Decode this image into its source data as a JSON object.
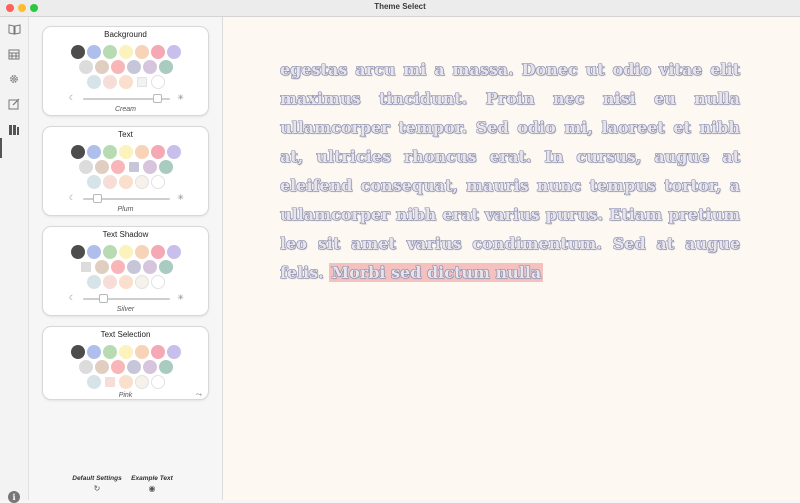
{
  "window": {
    "title": "Theme Select"
  },
  "sidebar": {
    "items": [
      {
        "name": "book-open-icon",
        "glyph": "📖"
      },
      {
        "name": "calendar-icon",
        "glyph": "▦"
      },
      {
        "name": "gear-icon",
        "glyph": "⚙"
      },
      {
        "name": "edit-icon",
        "glyph": "✎"
      },
      {
        "name": "library-icon",
        "glyph": "▮▮"
      }
    ],
    "info_glyph": "i"
  },
  "cards": [
    {
      "id": "background",
      "title": "Background",
      "label": "Cream",
      "rows": [
        [
          "#4d4d4d",
          "#aebfec",
          "#b8dbb4",
          "#fbf2bc",
          "#f7d3b7",
          "#f4a9b4",
          "#c9bfec"
        ],
        [
          "#dcdcdc",
          "#e0cfc0",
          "#f8b6b8",
          "#c6c6d8",
          "#d6c5dc",
          "#a9cbc0"
        ],
        [
          "#d6e3e8",
          "#f7ddd8",
          "#f9dfcc",
          "#f2f2f2",
          "#ffffff"
        ]
      ],
      "slider_level": 0.85
    },
    {
      "id": "text",
      "title": "Text",
      "label": "Plum",
      "rows": [
        [
          "#4d4d4d",
          "#aebfec",
          "#b8dbb4",
          "#fbf2bc",
          "#f7d3b7",
          "#f4a9b4",
          "#c9bfec"
        ],
        [
          "#dcdcdc",
          "#e0cfc0",
          "#f8b6b8",
          "#c6c6d8",
          "#d6c5dc",
          "#a9cbc0"
        ],
        [
          "#d6e3e8",
          "#f7ddd8",
          "#f9dfcc",
          "#f6f1ea",
          "#ffffff"
        ]
      ],
      "slider_level": 0.12
    },
    {
      "id": "text-shadow",
      "title": "Text Shadow",
      "label": "Silver",
      "rows": [
        [
          "#4d4d4d",
          "#aebfec",
          "#b8dbb4",
          "#fbf2bc",
          "#f7d3b7",
          "#f4a9b4",
          "#c9bfec"
        ],
        [
          "#dcdcdc",
          "#e0cfc0",
          "#f8b6b8",
          "#c6c6d8",
          "#d6c5dc",
          "#a9cbc0"
        ],
        [
          "#d6e3e8",
          "#f7ddd8",
          "#f9dfcc",
          "#f6f1ea",
          "#ffffff"
        ]
      ],
      "slider_level": 0.2
    },
    {
      "id": "text-selection",
      "title": "Text Selection",
      "label": "Pink",
      "rows": [
        [
          "#4d4d4d",
          "#aebfec",
          "#b8dbb4",
          "#fbf2bc",
          "#f7d3b7",
          "#f4a9b4",
          "#c9bfec"
        ],
        [
          "#dcdcdc",
          "#e0cfc0",
          "#f8b6b8",
          "#c6c6d8",
          "#d6c5dc",
          "#a9cbc0"
        ],
        [
          "#d6e3e8",
          "#f7ddd8",
          "#f9dfcc",
          "#f6f1ea",
          "#ffffff"
        ]
      ]
    }
  ],
  "footer": {
    "default_settings": "Default Settings",
    "example_text": "Example Text"
  },
  "reader": {
    "text": "egestas arcu mi a massa. Donec ut odio vitae elit maximus tincidunt. Proin nec nisi eu nulla ullamcorper tempor. Sed odio mi, laoreet et nibh at, ultricies rhoncus erat. In cursus, augue at eleifend consequat, mauris nunc tempus tortor, a ullamcorper nibh erat varius purus. Etiam pretium leo sit amet varius condimentum. Sed at augue felis. ",
    "selected_text": "Morbi sed dictum nulla"
  },
  "colors": {
    "reader_bg": "#fdf8f1",
    "text_fill": "#e8e4ee",
    "text_outline": "#8185a5",
    "selection": "#f5c1bf"
  }
}
